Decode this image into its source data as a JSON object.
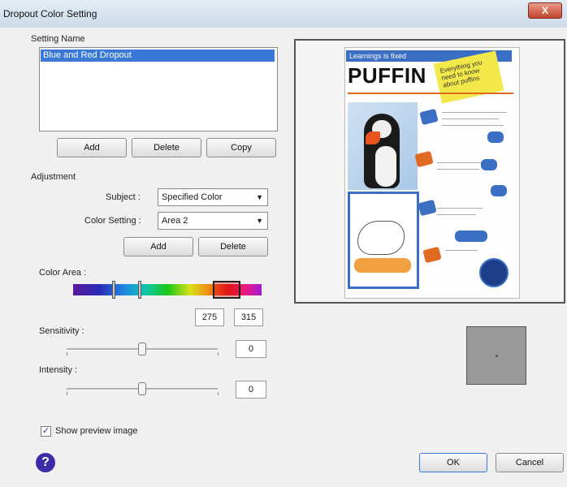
{
  "window": {
    "title": "Dropout Color Setting",
    "close_label": "X"
  },
  "setting_name": {
    "label": "Setting Name",
    "items": [
      "Blue and Red Dropout"
    ],
    "buttons": {
      "add": "Add",
      "delete": "Delete",
      "copy": "Copy"
    }
  },
  "adjustment": {
    "label": "Adjustment",
    "subject": {
      "label": "Subject :",
      "value": "Specified Color"
    },
    "color_setting": {
      "label": "Color Setting :",
      "value": "Area 2"
    },
    "buttons": {
      "add": "Add",
      "delete": "Delete"
    }
  },
  "color_area": {
    "label": "Color Area :",
    "start": "275",
    "end": "315"
  },
  "sensitivity": {
    "label": "Sensitivity :",
    "value": "0"
  },
  "intensity": {
    "label": "Intensity :",
    "value": "0"
  },
  "show_preview": {
    "label": "Show preview image",
    "checked": true,
    "check_glyph": "✓"
  },
  "help_glyph": "?",
  "footer": {
    "ok": "OK",
    "cancel": "Cancel"
  },
  "preview_doc": {
    "banner": "Learnings is fixed",
    "title": "PUFFIN",
    "note": "Everything you need to know about puffins"
  },
  "colors": {
    "accent": "#3b6fc4",
    "selection": "#3a78d8",
    "orange": "#e06a20",
    "note": "#f2e84a"
  }
}
